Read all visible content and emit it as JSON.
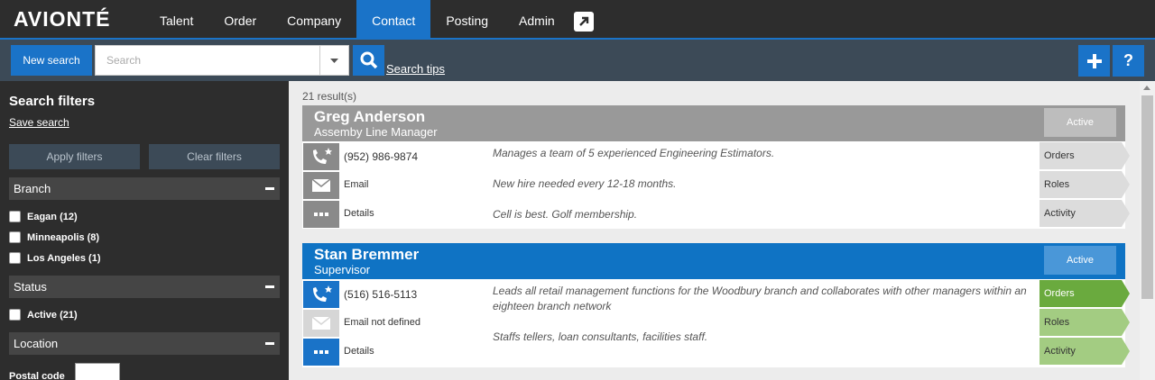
{
  "app": {
    "logo": "AVIONTÉ"
  },
  "nav": {
    "items": [
      {
        "label": "Talent"
      },
      {
        "label": "Order"
      },
      {
        "label": "Company"
      },
      {
        "label": "Contact",
        "active": true
      },
      {
        "label": "Posting"
      },
      {
        "label": "Admin"
      }
    ],
    "external_icon": "external-link-icon"
  },
  "search": {
    "new_search_label": "New search",
    "placeholder": "Search",
    "tips_label": "Search tips",
    "add_icon": "plus-icon",
    "help_icon": "help-icon"
  },
  "sidebar": {
    "title": "Search filters",
    "save_search": "Save search",
    "apply_label": "Apply filters",
    "clear_label": "Clear filters",
    "sections": [
      {
        "title": "Branch",
        "options": [
          "Eagan (12)",
          "Minneapolis (8)",
          "Los Angeles (1)"
        ]
      },
      {
        "title": "Status",
        "options": [
          "Active (21)"
        ]
      },
      {
        "title": "Location",
        "options": []
      }
    ],
    "postal_code_label": "Postal code"
  },
  "results": {
    "count": "21 result(s)",
    "cards": [
      {
        "name": "Greg Anderson",
        "role": "Assemby Line Manager",
        "status": "Active",
        "phone": "(952) 986-9874",
        "email": "Email",
        "details": "Details",
        "notes": [
          "Manages a team of 5 experienced Engineering Estimators.",
          "New hire needed every 12-18 months.",
          "Cell is best. Golf membership."
        ],
        "tags": [
          "Orders",
          "Roles",
          "Activity"
        ],
        "colors": {
          "header": "#999999",
          "status": "#bdbdbd",
          "icon": "#8a8a8a",
          "icon_disabled": "#8a8a8a",
          "tag": "#dcdcdc",
          "tag_active": "#dcdcdc"
        }
      },
      {
        "name": "Stan Bremmer",
        "role": "Supervisor",
        "status": "Active",
        "phone": "(516) 516-5113",
        "email": "Email not defined",
        "details": "Details",
        "notes": [
          "Leads all retail management functions for the Woodbury branch and collaborates with other managers within an eighteen branch network",
          "",
          "Staffs tellers, loan consultants, facilities staff."
        ],
        "tags": [
          "Orders",
          "Roles",
          "Activity"
        ],
        "colors": {
          "header": "#0f73c4",
          "status": "#4a97d8",
          "icon": "#1a73c8",
          "icon_disabled": "#d6d6d6",
          "tag": "#a3cc82",
          "tag_active": "#6aaa3e"
        }
      }
    ]
  }
}
